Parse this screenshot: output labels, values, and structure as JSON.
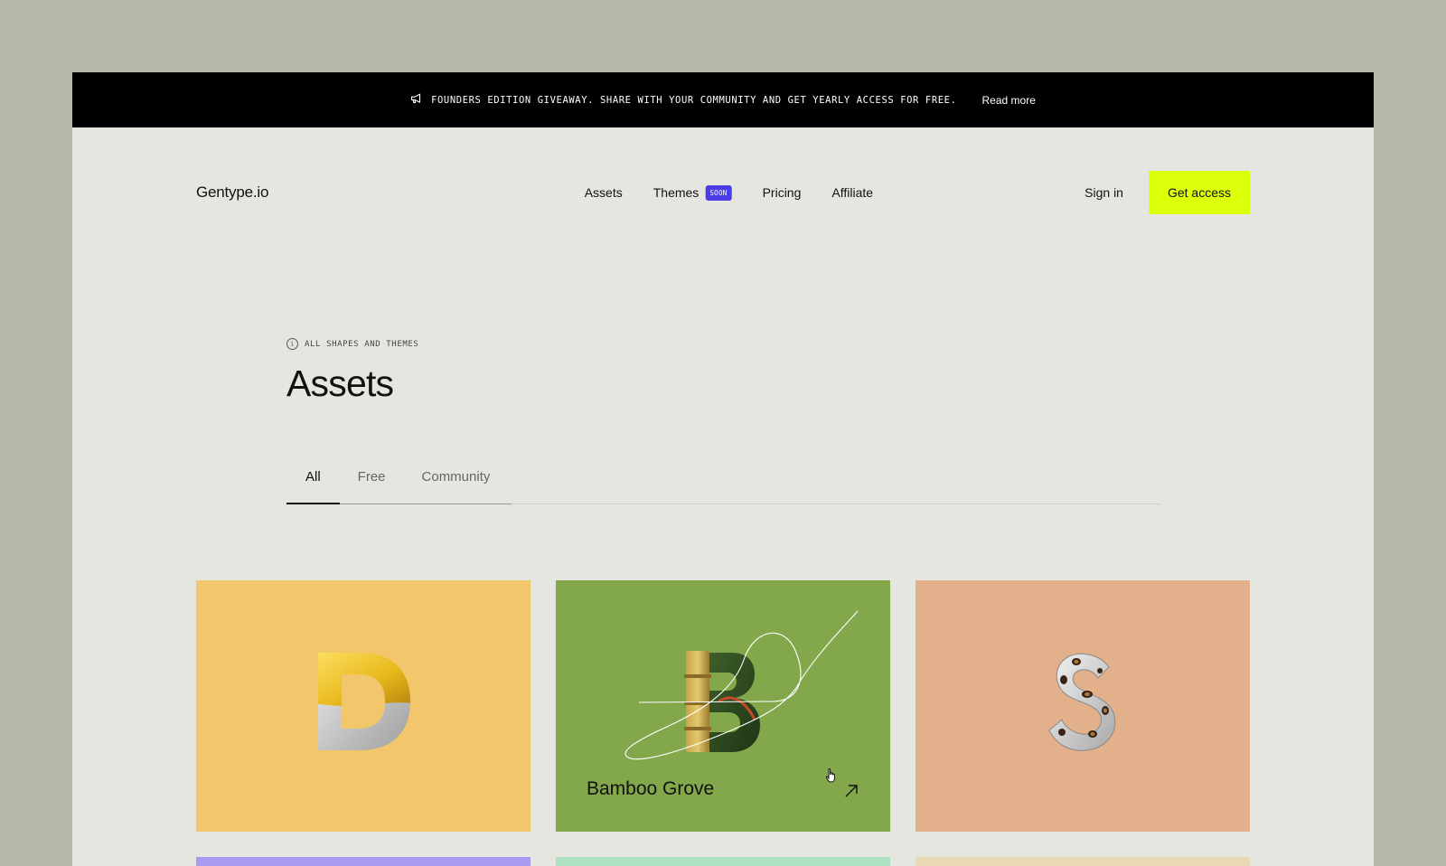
{
  "announcement": {
    "icon": "megaphone-icon",
    "text": "FOUNDERS EDITION GIVEAWAY. SHARE WITH YOUR COMMUNITY AND GET YEARLY ACCESS FOR FREE.",
    "link_label": "Read more"
  },
  "header": {
    "logo": "Gentype.io",
    "nav": [
      {
        "label": "Assets"
      },
      {
        "label": "Themes",
        "badge": "SOON"
      },
      {
        "label": "Pricing"
      },
      {
        "label": "Affiliate"
      }
    ],
    "sign_in_label": "Sign in",
    "cta_label": "Get access",
    "cta_color": "#dcff0a",
    "badge_color": "#4a3ce6"
  },
  "hero": {
    "eyebrow_icon": "info-icon",
    "eyebrow": "ALL SHAPES AND THEMES",
    "title": "Assets"
  },
  "tabs": [
    {
      "label": "All",
      "active": true
    },
    {
      "label": "Free",
      "active": false
    },
    {
      "label": "Community",
      "active": false
    }
  ],
  "cards": [
    {
      "letter": "D",
      "color": "#f2c76b",
      "art": "glossy-yellow-d"
    },
    {
      "letter": "B",
      "color": "#82a84b",
      "art": "bamboo-b",
      "title": "Bamboo Grove",
      "hovered": true
    },
    {
      "letter": "S",
      "color": "#e2b08a",
      "art": "leopard-fur-s"
    },
    {
      "color": "#a99cf0"
    },
    {
      "color": "#aee0c4"
    },
    {
      "color": "#e8d9b2"
    }
  ]
}
